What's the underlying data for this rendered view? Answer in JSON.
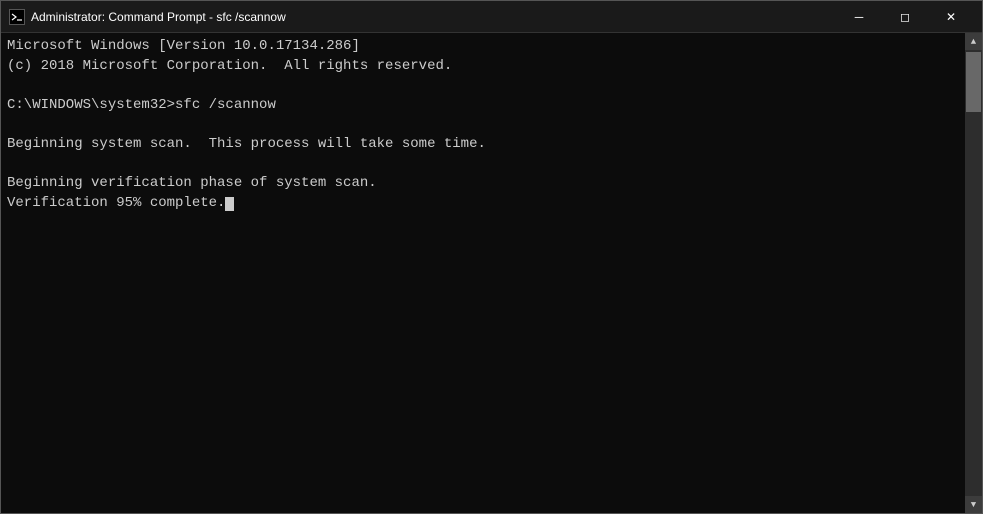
{
  "titleBar": {
    "icon": "cmd-icon",
    "title": "Administrator: Command Prompt - sfc /scannow",
    "minimizeLabel": "minimize-btn",
    "maximizeLabel": "maximize-btn",
    "closeLabel": "close-btn"
  },
  "console": {
    "lines": [
      "Microsoft Windows [Version 10.0.17134.286]",
      "(c) 2018 Microsoft Corporation.  All rights reserved.",
      "",
      "C:\\WINDOWS\\system32>sfc /scannow",
      "",
      "Beginning system scan.  This process will take some time.",
      "",
      "Beginning verification phase of system scan.",
      "Verification 95% complete."
    ]
  },
  "controls": {
    "minimize": "─",
    "maximize": "□",
    "close": "✕"
  }
}
